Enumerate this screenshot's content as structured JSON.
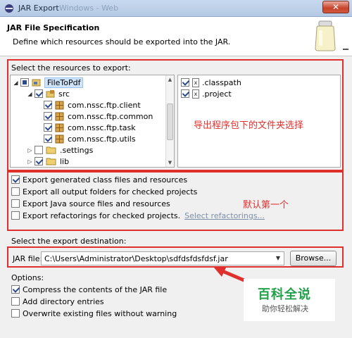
{
  "window": {
    "title": "JAR Export",
    "ghost_title": "Windows - Web"
  },
  "header": {
    "title": "JAR File Specification",
    "description": "Define which resources should be exported into the JAR."
  },
  "resources": {
    "label": "Select the resources to export:",
    "tree": {
      "project": "FileToPdf",
      "src": "src",
      "packages": [
        "com.nssc.ftp.client",
        "com.nssc.ftp.common",
        "com.nssc.ftp.task",
        "com.nssc.ftp.utils"
      ],
      "settings": ".settings",
      "lib": "lib"
    },
    "files": [
      ".classpath",
      ".project"
    ],
    "annotation": "导出程序包下的文件夹选择"
  },
  "export_options": {
    "items": [
      {
        "label": "Export generated class files and resources",
        "checked": true
      },
      {
        "label": "Export all output folders for checked projects",
        "checked": false
      },
      {
        "label": "Export Java source files and resources",
        "checked": false
      },
      {
        "label": "Export refactorings for checked projects.",
        "checked": false
      }
    ],
    "refactor_link": "Select refactorings...",
    "annotation": "默认第一个"
  },
  "destination": {
    "label": "Select the export destination:",
    "jar_label": "JAR file:",
    "jar_value": "C:\\Users\\Administrator\\Desktop\\sdfdsfdsfdsf.jar",
    "browse": "Browse..."
  },
  "options": {
    "label": "Options:",
    "items": [
      {
        "label": "Compress the contents of the JAR file",
        "checked": true
      },
      {
        "label": "Add directory entries",
        "checked": false
      },
      {
        "label": "Overwrite existing files without warning",
        "checked": false
      }
    ]
  },
  "watermark": {
    "main": "百科全说",
    "sub": "助你轻松解决"
  },
  "colors": {
    "annotation_red": "#e0302e",
    "watermark_green": "#21a14a"
  }
}
